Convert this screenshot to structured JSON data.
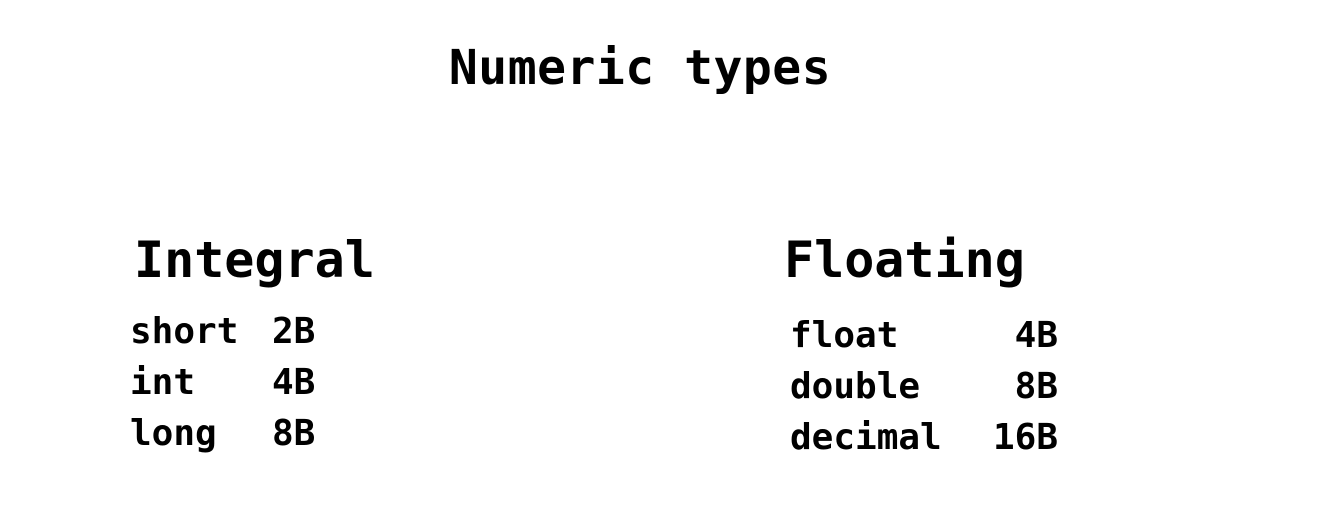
{
  "title": "Numeric types",
  "columns": [
    {
      "heading": "Integral",
      "rows": [
        {
          "name": "short",
          "size": "2B"
        },
        {
          "name": "int",
          "size": "4B"
        },
        {
          "name": "long",
          "size": "8B"
        }
      ]
    },
    {
      "heading": "Floating",
      "rows": [
        {
          "name": "float",
          "size": "4B"
        },
        {
          "name": "double",
          "size": "8B"
        },
        {
          "name": "decimal",
          "size": "16B"
        }
      ]
    }
  ]
}
